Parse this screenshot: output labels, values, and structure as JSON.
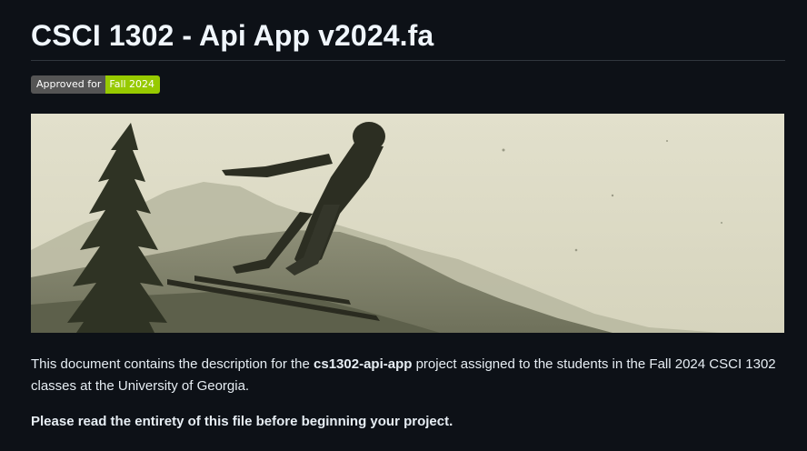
{
  "page": {
    "title": "CSCI 1302 - Api App v2024.fa"
  },
  "badge": {
    "label": "Approved for",
    "value": "Fall 2024",
    "label_color": "#555555",
    "value_color": "#97ca00"
  },
  "hero_image": {
    "subject": "vintage photo of a ski jumper in flight over hills"
  },
  "description": {
    "prefix": "This document contains the description for the ",
    "project_name": "cs1302-api-app",
    "suffix": " project assigned to the students in the Fall 2024 CSCI 1302 classes at the University of Georgia."
  },
  "note": "Please read the entirety of this file before beginning your project.",
  "colors": {
    "background": "#0d1117",
    "text": "#e6edf3",
    "divider": "#30363d"
  }
}
